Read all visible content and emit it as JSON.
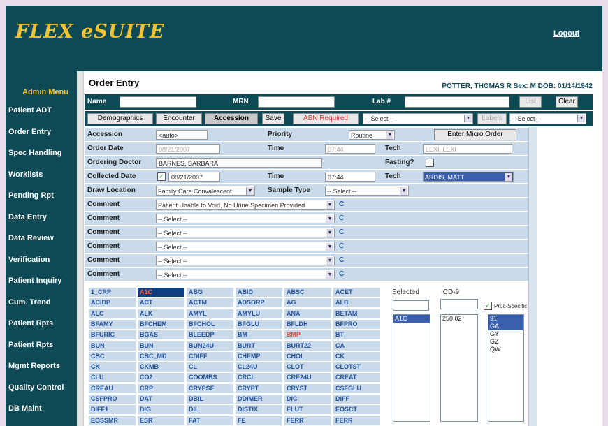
{
  "app": {
    "logo": "FLEX eSUITE",
    "logout": "Logout"
  },
  "sidebar": {
    "title": "Admin Menu",
    "items": [
      "Patient ADT",
      "Order Entry",
      "Spec Handling",
      "Worklists",
      "Pending Rpt",
      "Data Entry",
      "Data Review",
      "Verification",
      "Patient Inquiry",
      "Cum. Trend",
      "Patient Rpts",
      "Patient Rpts",
      "Mgmt Reports",
      "Quality Control",
      "DB Maint"
    ]
  },
  "page": {
    "title": "Order Entry",
    "patient": "POTTER, THOMAS R Sex: M DOB: 01/14/1942"
  },
  "search": {
    "name_label": "Name",
    "mrn_label": "MRN",
    "lab_label": "Lab #",
    "list_btn": "List",
    "clear_btn": "Clear"
  },
  "toolbar": {
    "demographics": "Demographics",
    "encounter": "Encounter",
    "accession": "Accession",
    "save": "Save",
    "abn": "ABN Required",
    "select1": "-- Select --",
    "labels": "Labels",
    "select2": "-- Select --"
  },
  "form": {
    "accession_label": "Accession",
    "accession_value": "<auto>",
    "priority_label": "Priority",
    "priority_value": "Routine",
    "micro_btn": "Enter Micro Order",
    "order_date_label": "Order Date",
    "order_date_value": "08/21/2007",
    "time_label": "Time",
    "order_time_value": "07:44",
    "tech_label": "Tech",
    "order_tech_value": "LEXI, LEXI",
    "ordering_doctor_label": "Ordering Doctor",
    "ordering_doctor_value": "BARNES, BARBARA",
    "fasting_label": "Fasting?",
    "collected_date_label": "Collected Date",
    "collected_date_value": "08/21/2007",
    "collected_time_label": "Time",
    "collected_time_value": "07:44",
    "collected_tech_label": "Tech",
    "collected_tech_value": "ARDIS, MATT",
    "draw_location_label": "Draw Location",
    "draw_location_value": "Family Care Convalescent",
    "sample_type_label": "Sample Type",
    "sample_type_value": "-- Select --",
    "comment_label": "Comment",
    "comments": [
      "Patient Unable to Void, No Urine Specimen Provided",
      "-- Select --",
      "-- Select --",
      "-- Select --",
      "-- Select --",
      "-- Select --"
    ],
    "c_link": "C"
  },
  "tests": [
    [
      "1_CRP",
      "A1C",
      "ABG",
      "ABID",
      "ABSC",
      "ACET"
    ],
    [
      "ACIDP",
      "ACT",
      "ACTM",
      "ADSORP",
      "AG",
      "ALB"
    ],
    [
      "ALC",
      "ALK",
      "AMYL",
      "AMYLU",
      "ANA",
      "BETAM"
    ],
    [
      "BFAMY",
      "BFCHEM",
      "BFCHOL",
      "BFGLU",
      "BFLDH",
      "BFPRO"
    ],
    [
      "BFURIC",
      "BGAS",
      "BLEEDP",
      "BM",
      "BMP",
      "BT"
    ],
    [
      "BUN",
      "BUN",
      "BUN24U",
      "BURT",
      "BURT22",
      "CA"
    ],
    [
      "CBC",
      "CBC_MD",
      "CDIFF",
      "CHEMP",
      "CHOL",
      "CK"
    ],
    [
      "CK",
      "CKMB",
      "CL",
      "CL24U",
      "CLOT",
      "CLOTST"
    ],
    [
      "CLU",
      "CO2",
      "COOMBS",
      "CRCL",
      "CRE24U",
      "CREAT"
    ],
    [
      "CREAU",
      "CRP",
      "CRYPSF",
      "CRYPT",
      "CRYST",
      "CSFGLU"
    ],
    [
      "CSFPRO",
      "DAT",
      "DBIL",
      "DDIMER",
      "DIC",
      "DIFF"
    ],
    [
      "DIFF1",
      "DIG",
      "DIL",
      "DISTIX",
      "ELUT",
      "EOSCT"
    ],
    [
      "EOSSMR",
      "ESR",
      "FAT",
      "FE",
      "FERR",
      "FERR"
    ]
  ],
  "selected_test": "A1C",
  "red_tests": [
    "BMP"
  ],
  "side": {
    "selected_label": "Selected",
    "icd_label": "ICD-9",
    "proc_specific": "Proc-Specific",
    "selected_items": [
      "A1C"
    ],
    "icd_items": [
      "250.02"
    ],
    "proc_items": [
      "91",
      "GA",
      "GY",
      "GZ",
      "QW"
    ],
    "proc_selected": [
      "91",
      "GA"
    ]
  }
}
